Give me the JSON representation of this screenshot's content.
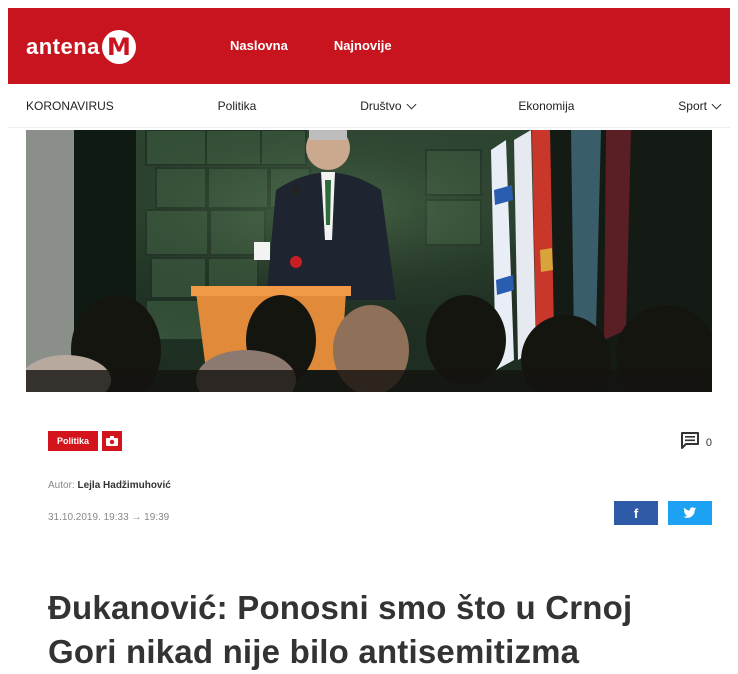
{
  "brand": {
    "logo_text": "antena",
    "logo_letter": "M"
  },
  "top_nav": [
    {
      "label": "Naslovna"
    },
    {
      "label": "Najnovije"
    }
  ],
  "categories": [
    {
      "label": "KORONAVIRUS"
    },
    {
      "label": "Politika"
    },
    {
      "label": "Društvo"
    },
    {
      "label": "Ekonomija"
    },
    {
      "label": "Sport"
    }
  ],
  "article": {
    "category_badge": "Politika",
    "comment_count": "0",
    "author_label": "Autor:",
    "author_name": "Lejla Hadžimuhović",
    "date": "31.10.2019. 19:33 → 19:39",
    "share_facebook": "f",
    "headline": "Đukanović: Ponosni smo što u Crnoj Gori nikad nije bilo antisemitizma"
  },
  "colors": {
    "brand_red": "#c8141e",
    "facebook_blue": "#2f5aa8",
    "twitter_blue": "#1da1f2"
  }
}
